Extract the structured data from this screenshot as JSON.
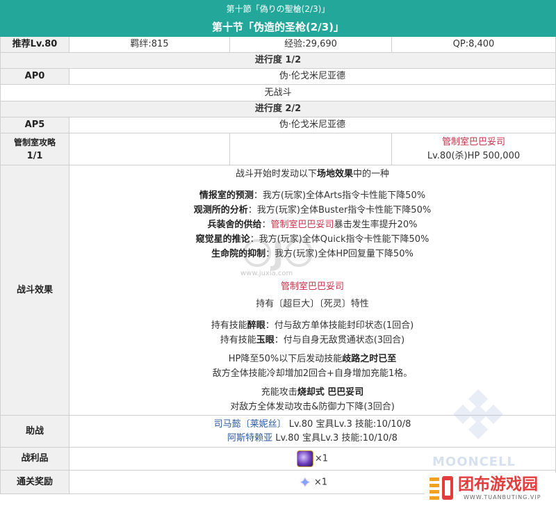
{
  "header": {
    "jp_title": "第十節「偽りの聖槍(2/3)」",
    "cn_title": "第十节「伪造的圣枪(2/3)」"
  },
  "summary": {
    "label": "推荐Lv.80",
    "bond": "羁绊:815",
    "exp": "经验:29,690",
    "qp": "QP:8,400"
  },
  "progress1": {
    "title": "进行度 1/2",
    "ap_label": "AP0",
    "enemy": "伪·伦戈米尼亚德",
    "no_battle": "无战斗"
  },
  "progress2": {
    "title": "进行度 2/2",
    "ap_label": "AP5",
    "enemy": "伪·伦戈米尼亚德",
    "wave_label": "管制室攻略",
    "wave_count": "1/1",
    "boss_name": "管制室巴巴妥司",
    "boss_stats": "Lv.80(杀)HP 500,000"
  },
  "effects": {
    "label": "战斗效果",
    "intro_a": "战斗开始时发动以下",
    "intro_b": "场地效果",
    "intro_c": "中的一种",
    "fields": [
      {
        "name": "情报室的预测",
        "text": "：我方(玩家)全体Arts指令卡性能下降50%"
      },
      {
        "name": "观测所的分析",
        "text": "：我方(玩家)全体Buster指令卡性能下降50%"
      },
      {
        "name": "兵装舍的供给",
        "text": "暴击发生率提升20%",
        "mid": "：",
        "red": "管制室巴巴妥司"
      },
      {
        "name": "窥觉星的推论",
        "text": "：我方(玩家)全体Quick指令卡性能下降50%"
      },
      {
        "name": "生命院的抑制",
        "text": "：我方(玩家)全体HP回复量下降50%"
      }
    ],
    "boss_name": "管制室巴巴妥司",
    "traits": "持有〔超巨大〕〔死灵〕特性",
    "skill1_pre": "持有技能",
    "skill1_name": "醉眼",
    "skill1_text": "：付与敌方单体技能封印状态(1回合)",
    "skill2_pre": "持有技能",
    "skill2_name": "玉眼",
    "skill2_text": "：付与自身无敌贯通状态(3回合)",
    "hp_pre": "HP降至50%以下后发动技能",
    "hp_skill": "歧路之时已至",
    "hp_text": "敌方全体技能冷却增加2回合+自身增加充能1格。",
    "np_pre": "充能攻击",
    "np_name": "烧却式 巴巴妥司",
    "np_text": "对敌方全体发动攻击&防御力下降(3回合)"
  },
  "support": {
    "label": "助战",
    "s1_name": "司马懿〔莱妮丝〕",
    "s1_text": " Lv.80 宝具Lv.3 技能:10/10/8",
    "s2_name": "阿斯特赖亚",
    "s2_text": " Lv.80 宝具Lv.3 技能:10/10/8"
  },
  "drops": {
    "label": "战利品",
    "count": "×1",
    "icon": "purple-gem-icon"
  },
  "reward": {
    "label": "通关奖励",
    "count": "×1",
    "icon": "saint-quartz-icon"
  },
  "watermarks": {
    "juxia_url": "www.juxia.com",
    "mooncell": "MOONCELL",
    "site_name": "团布游戏园",
    "site_url": "WWW.TUANBUTING.VIP"
  },
  "colors": {
    "header_bg": "#23a79a",
    "boss_red": "#c9324b",
    "servant_blue": "#2c5aa0"
  }
}
